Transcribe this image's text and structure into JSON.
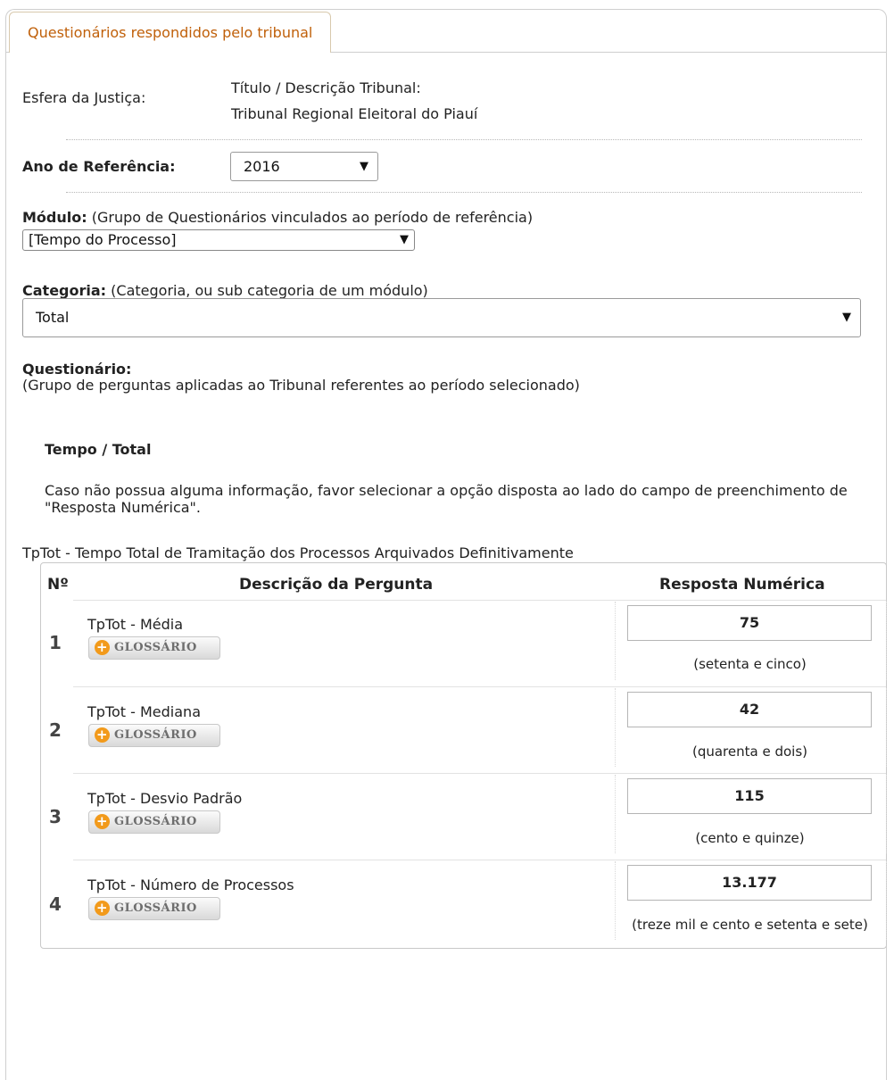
{
  "tab": {
    "label": "Questionários respondidos pelo tribunal"
  },
  "header": {
    "esfera_label": "Esfera da Justiça:",
    "titulo_label": "Título / Descrição Tribunal:",
    "tribunal": "Tribunal Regional Eleitoral do Piauí"
  },
  "ano": {
    "label": "Ano de Referência:",
    "value": "2016"
  },
  "modulo": {
    "label": "Módulo:",
    "hint": "(Grupo de Questionários vinculados ao período de referência)",
    "value": "[Tempo do Processo]"
  },
  "categoria": {
    "label": "Categoria:",
    "hint": "(Categoria, ou sub categoria de um módulo)",
    "value": "Total"
  },
  "questionario": {
    "label": "Questionário:",
    "hint": "(Grupo de perguntas aplicadas ao Tribunal referentes ao período selecionado)",
    "section_title": "Tempo / Total",
    "instructions": "Caso não possua alguma informação, favor selecionar a opção disposta ao lado do campo de preenchimento de \"Resposta Numérica\"."
  },
  "table": {
    "caption": "TpTot - Tempo Total de Tramitação dos Processos Arquivados Definitivamente",
    "headers": {
      "num": "Nº",
      "desc": "Descrição da Pergunta",
      "resp": "Resposta Numérica"
    },
    "glossary_label": "GLOSSÁRIO",
    "rows": [
      {
        "num": "1",
        "question": "TpTot - Média",
        "answer": "75",
        "answer_text": "(setenta e cinco)"
      },
      {
        "num": "2",
        "question": "TpTot - Mediana",
        "answer": "42",
        "answer_text": "(quarenta e dois)"
      },
      {
        "num": "3",
        "question": "TpTot - Desvio Padrão",
        "answer": "115",
        "answer_text": "(cento e quinze)"
      },
      {
        "num": "4",
        "question": "TpTot - Número de Processos",
        "answer": "13.177",
        "answer_text": "(treze mil e cento e setenta e sete)"
      }
    ]
  }
}
